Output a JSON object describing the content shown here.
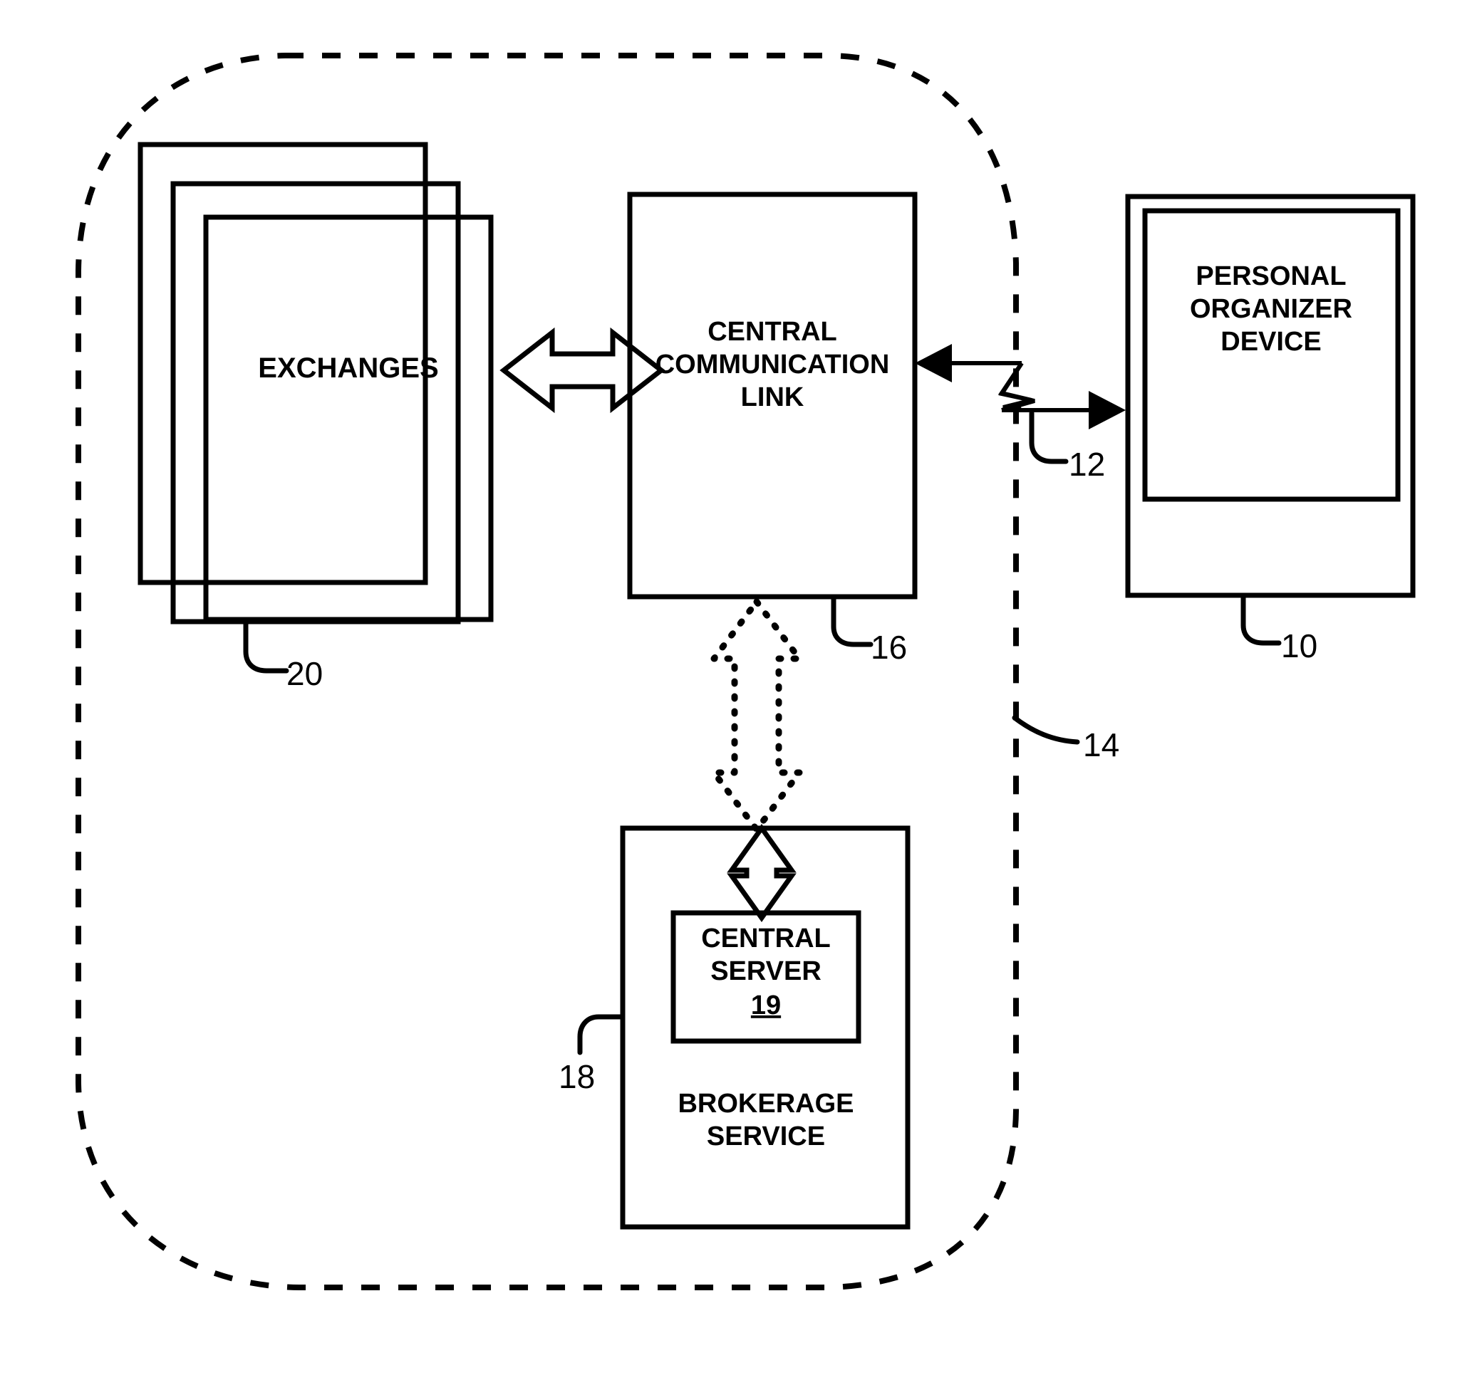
{
  "figure": {
    "type": "patent-block-diagram",
    "background_color": "#ffffff",
    "line_color": "#000000"
  },
  "boundary": {
    "name": "system-boundary",
    "style": "dashed-rounded-rectangle",
    "ref_label": "14"
  },
  "blocks": {
    "exchanges": {
      "label": "EXCHANGES",
      "ref_label": "20",
      "stacked_count": 3
    },
    "central_communication_link": {
      "line1": "CENTRAL",
      "line2": "COMMUNICATION",
      "line3": "LINK",
      "ref_label": "16"
    },
    "personal_organizer_device": {
      "line1": "PERSONAL",
      "line2": "ORGANIZER",
      "line3": "DEVICE",
      "ref_label": "10"
    },
    "brokerage_service": {
      "line1": "BROKERAGE",
      "line2": "SERVICE",
      "ref_label": "18"
    },
    "central_server": {
      "line1": "CENTRAL",
      "line2": "SERVER",
      "ref_label": "19"
    }
  },
  "connectors": {
    "exchanges_to_link": {
      "name": "hollow-bidirectional-block-arrow",
      "orientation": "horizontal"
    },
    "link_to_brokerage": {
      "name": "dotted-bidirectional-arrow",
      "orientation": "vertical"
    },
    "brokerage_to_server": {
      "name": "hollow-bidirectional-block-arrow",
      "orientation": "vertical"
    },
    "wireless_link": {
      "name": "lightning-bolt-wireless-link",
      "ref_label": "12",
      "arrow_in_label": "to central communication link",
      "arrow_out_label": "to personal organizer device"
    }
  }
}
